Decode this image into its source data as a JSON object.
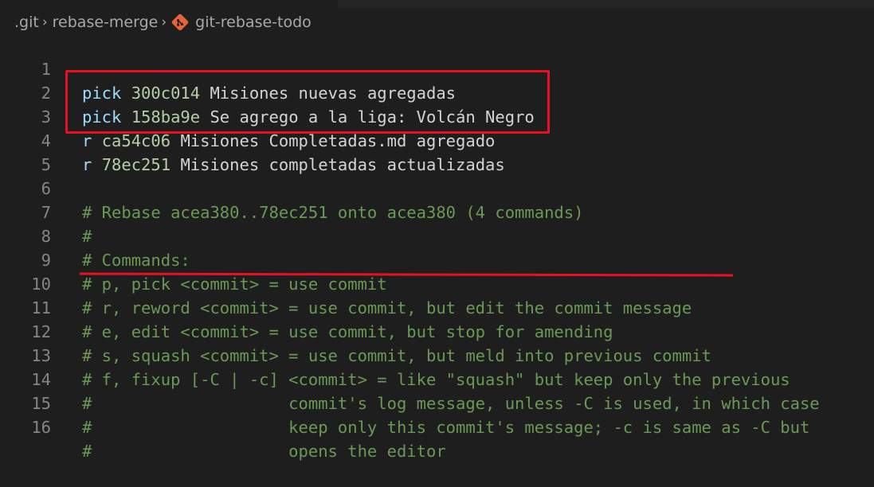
{
  "breadcrumb": {
    "segments": [
      ".git",
      "rebase-merge",
      "git-rebase-todo"
    ],
    "file_icon": "git-file-icon",
    "separator_icon": "chevron-right-icon"
  },
  "colors": {
    "keyword": "#9cdcfe",
    "hash": "#b5cea8",
    "message": "#d4d4d4",
    "comment": "#6a9955",
    "annotation": "#e81123",
    "git_icon": "#e8623a"
  },
  "editor": {
    "lines": [
      {
        "num": "1",
        "cmd": "pick",
        "hash": "300c014",
        "msg": "Misiones nuevas agregadas"
      },
      {
        "num": "2",
        "cmd": "pick",
        "hash": "158ba9e",
        "msg": "Se agrego a la liga: Volcán Negro"
      },
      {
        "num": "3",
        "cmd": "r",
        "hash": "ca54c06",
        "msg": "Misiones Completadas.md agregado"
      },
      {
        "num": "4",
        "cmd": "r",
        "hash": "78ec251",
        "msg": "Misiones completadas actualizadas"
      },
      {
        "num": "5",
        "text": ""
      },
      {
        "num": "6",
        "text": "# Rebase acea380..78ec251 onto acea380 (4 commands)"
      },
      {
        "num": "7",
        "text": "#"
      },
      {
        "num": "8",
        "text": "# Commands:"
      },
      {
        "num": "9",
        "text": "# p, pick <commit> = use commit"
      },
      {
        "num": "10",
        "text": "# r, reword <commit> = use commit, but edit the commit message"
      },
      {
        "num": "11",
        "text": "# e, edit <commit> = use commit, but stop for amending"
      },
      {
        "num": "12",
        "text": "# s, squash <commit> = use commit, but meld into previous commit"
      },
      {
        "num": "13",
        "text": "# f, fixup [-C | -c] <commit> = like \"squash\" but keep only the previous"
      },
      {
        "num": "14",
        "text": "#                    commit's log message, unless -C is used, in which case"
      },
      {
        "num": "15",
        "text": "#                    keep only this commit's message; -c is same as -C but"
      },
      {
        "num": "16",
        "text": "#                    opens the editor"
      }
    ]
  }
}
